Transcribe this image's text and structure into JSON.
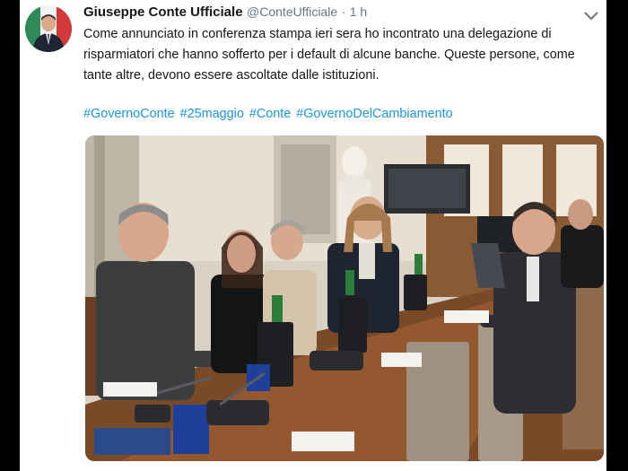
{
  "tweet": {
    "author_name": "Giuseppe Conte Ufficiale",
    "handle": "@ConteUfficiale",
    "separator": "·",
    "time": "1 h",
    "text": "Come annunciato in conferenza stampa ieri sera ho incontrato una delegazione di risparmiatori che hanno sofferto per i default di alcune banche. Queste persone, come tante altre, devono essere ascoltate dalle istituzioni.",
    "hashtags": [
      "#GovernoConte",
      "#25maggio",
      "#Conte",
      "#GovernoDelCambiamento"
    ],
    "link_color": "#1b95e0"
  }
}
